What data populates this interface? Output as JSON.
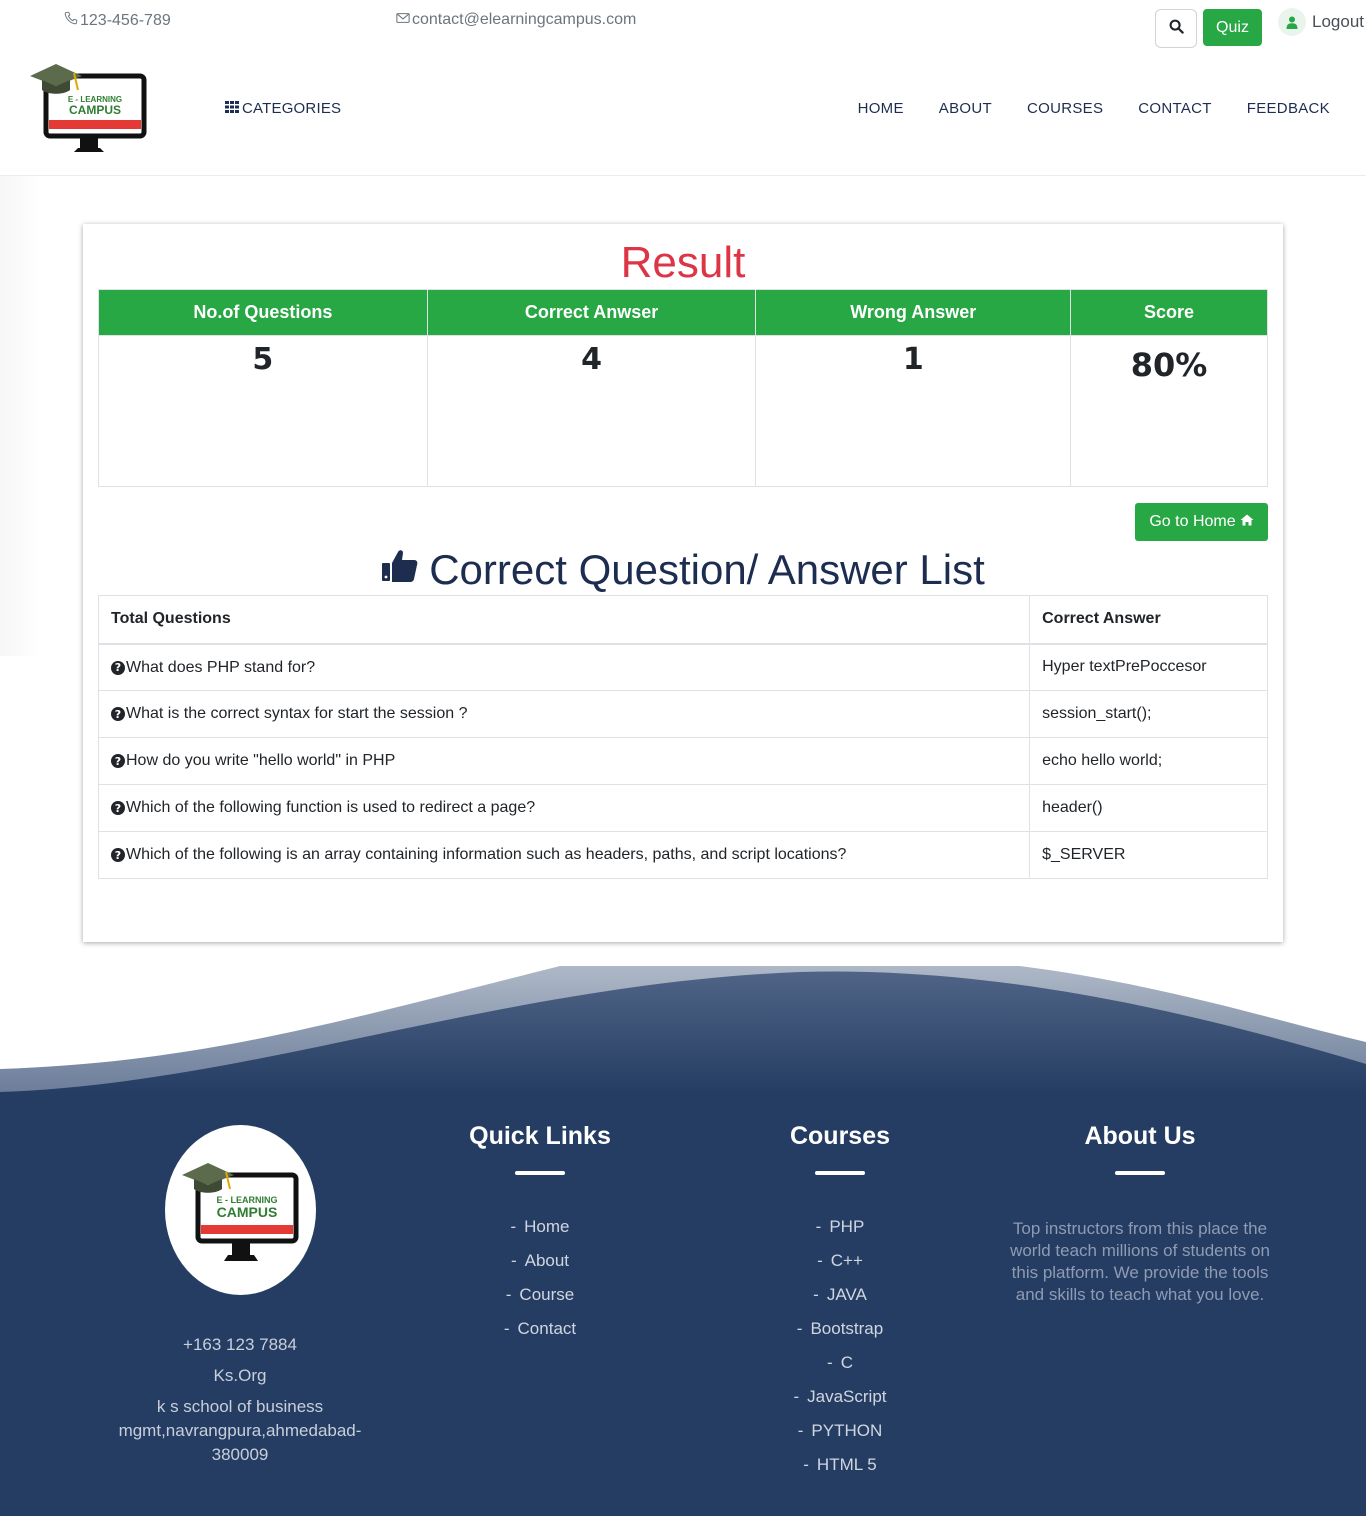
{
  "topbar": {
    "phone": "123-456-789",
    "email": "contact@elearningcampus.com",
    "quiz_label": "Quiz",
    "logout_label": "Logout"
  },
  "logo": {
    "line1": "E - LEARNING",
    "line2": "CAMPUS"
  },
  "nav": {
    "categories_label": "CATEGORIES",
    "items": [
      "HOME",
      "ABOUT",
      "COURSES",
      "CONTACT",
      "FEEDBACK"
    ]
  },
  "result": {
    "title": "Result",
    "headers": [
      "No.of Questions",
      "Correct Anwser",
      "Wrong Answer",
      "Score"
    ],
    "values": [
      "5",
      "4",
      "1",
      "80%"
    ],
    "home_button": "Go to Home"
  },
  "answers": {
    "title": "Correct Question/ Answer List",
    "headers": [
      "Total Questions",
      "Correct Answer"
    ],
    "rows": [
      {
        "question": "What does PHP stand for?",
        "answer": "Hyper textPrePoccesor"
      },
      {
        "question": "What is the correct syntax for start the session ?",
        "answer": "session_start();"
      },
      {
        "question": "How do you write \"hello world\" in PHP",
        "answer": "echo hello world;"
      },
      {
        "question": "Which of the following function is used to redirect a page?",
        "answer": "header()"
      },
      {
        "question": "Which of the following is an array containing information such as headers, paths, and script locations?",
        "answer": "$_SERVER"
      }
    ]
  },
  "footer": {
    "contact": {
      "phone": "+163 123 7884",
      "org": "Ks.Org",
      "address": "k s school of business mgmt,navrangpura,ahmedabad-380009"
    },
    "quick_links": {
      "title": "Quick Links",
      "items": [
        "Home",
        "About",
        "Course",
        "Contact"
      ]
    },
    "courses": {
      "title": "Courses",
      "items": [
        "PHP",
        "C++",
        "JAVA",
        "Bootstrap",
        "C",
        "JavaScript",
        "PYTHON",
        "HTML 5"
      ]
    },
    "about": {
      "title": "About Us",
      "text": "Top instructors from this place the world teach millions of students on this platform. We provide the tools and skills to teach what you love."
    }
  },
  "colors": {
    "accent_green": "#28a745",
    "result_red": "#dc3545",
    "navy": "#1d2d50",
    "footer_bg": "#253d63"
  }
}
